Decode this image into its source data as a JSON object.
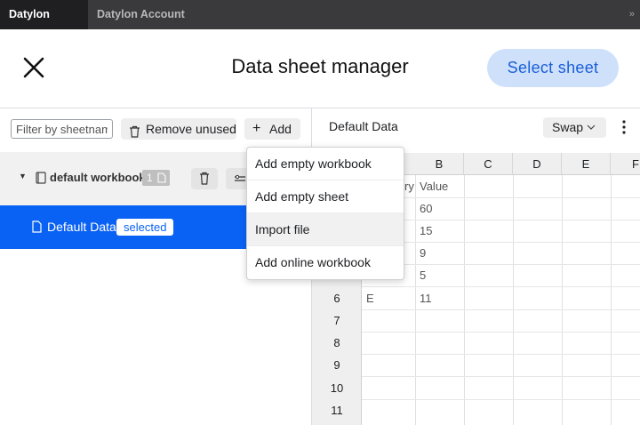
{
  "tabs": [
    {
      "label": "Datylon Editor",
      "active": true
    },
    {
      "label": "Datylon Account",
      "active": false
    }
  ],
  "tab_overflow": "»",
  "header": {
    "title": "Data sheet manager",
    "select_label": "Select sheet"
  },
  "toolbar": {
    "filter_placeholder": "Filter by sheetname",
    "remove_label": "Remove unused",
    "add_label": "Add"
  },
  "workbook": {
    "name": "default workbook",
    "sheet_count": "1"
  },
  "sheet": {
    "name": "Default Data",
    "badge": "selected"
  },
  "right_panel": {
    "title": "Default Data",
    "swap_label": "Swap"
  },
  "add_menu": {
    "items": [
      "Add empty workbook",
      "Add empty sheet",
      "Import file",
      "Add online workbook"
    ],
    "highlighted_index": 2
  },
  "grid": {
    "columns": [
      "B",
      "C",
      "D",
      "E",
      "F"
    ],
    "row_numbers": [
      "6",
      "7",
      "8",
      "9",
      "10",
      "11"
    ],
    "cells": {
      "a1_partial": "ry",
      "b1": "Value",
      "b2": "60",
      "b3": "15",
      "b4": "9",
      "b5": "5",
      "a6": "E",
      "b6": "11"
    }
  },
  "colors": {
    "accent": "#0a62f5",
    "select_button_bg": "#cfe0fb",
    "select_button_text": "#1a5fd6",
    "tabstrip_bg": "#3a3a3c"
  }
}
